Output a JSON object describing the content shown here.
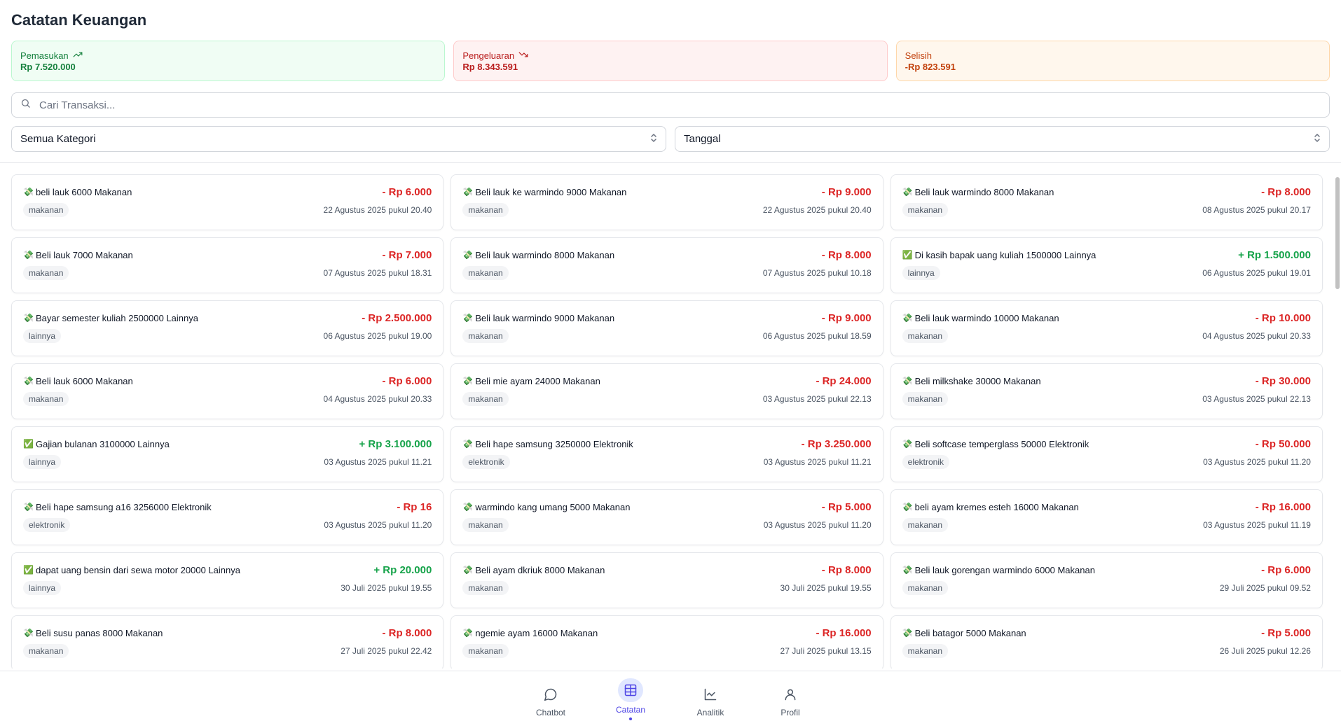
{
  "page_title": "Catatan Keuangan",
  "summary": {
    "income": {
      "label": "Pemasukan",
      "value": "Rp 7.520.000",
      "icon": "trending-up-icon",
      "color": "#15803d"
    },
    "expense": {
      "label": "Pengeluaran",
      "value": "Rp 8.343.591",
      "icon": "trending-down-icon",
      "color": "#b91c1c"
    },
    "difference": {
      "label": "Selisih",
      "value": "-Rp 823.591",
      "color": "#c2410c"
    }
  },
  "search": {
    "placeholder": "Cari Transaksi...",
    "value": ""
  },
  "filters": {
    "category": "Semua Kategori",
    "date": "Tanggal"
  },
  "transactions": [
    {
      "emoji": "💸",
      "desc": "beli lauk 6000 Makanan",
      "amount": "- Rp 6.000",
      "type": "expense",
      "category": "makanan",
      "date": "22 Agustus 2025 pukul 20.40"
    },
    {
      "emoji": "💸",
      "desc": "Beli lauk ke warmindo 9000 Makanan",
      "amount": "- Rp 9.000",
      "type": "expense",
      "category": "makanan",
      "date": "22 Agustus 2025 pukul 20.40"
    },
    {
      "emoji": "💸",
      "desc": "Beli lauk warmindo 8000 Makanan",
      "amount": "- Rp 8.000",
      "type": "expense",
      "category": "makanan",
      "date": "08 Agustus 2025 pukul 20.17"
    },
    {
      "emoji": "💸",
      "desc": "Beli lauk 7000 Makanan",
      "amount": "- Rp 7.000",
      "type": "expense",
      "category": "makanan",
      "date": "07 Agustus 2025 pukul 18.31"
    },
    {
      "emoji": "💸",
      "desc": "Beli lauk warmindo 8000 Makanan",
      "amount": "- Rp 8.000",
      "type": "expense",
      "category": "makanan",
      "date": "07 Agustus 2025 pukul 10.18"
    },
    {
      "emoji": "✅",
      "desc": "Di kasih bapak uang kuliah 1500000 Lainnya",
      "amount": "+ Rp 1.500.000",
      "type": "income",
      "category": "lainnya",
      "date": "06 Agustus 2025 pukul 19.01"
    },
    {
      "emoji": "💸",
      "desc": "Bayar semester kuliah 2500000 Lainnya",
      "amount": "- Rp 2.500.000",
      "type": "expense",
      "category": "lainnya",
      "date": "06 Agustus 2025 pukul 19.00"
    },
    {
      "emoji": "💸",
      "desc": "Beli lauk warmindo 9000 Makanan",
      "amount": "- Rp 9.000",
      "type": "expense",
      "category": "makanan",
      "date": "06 Agustus 2025 pukul 18.59"
    },
    {
      "emoji": "💸",
      "desc": "Beli lauk warmindo 10000 Makanan",
      "amount": "- Rp 10.000",
      "type": "expense",
      "category": "makanan",
      "date": "04 Agustus 2025 pukul 20.33"
    },
    {
      "emoji": "💸",
      "desc": "Beli lauk 6000 Makanan",
      "amount": "- Rp 6.000",
      "type": "expense",
      "category": "makanan",
      "date": "04 Agustus 2025 pukul 20.33"
    },
    {
      "emoji": "💸",
      "desc": "Beli mie ayam 24000 Makanan",
      "amount": "- Rp 24.000",
      "type": "expense",
      "category": "makanan",
      "date": "03 Agustus 2025 pukul 22.13"
    },
    {
      "emoji": "💸",
      "desc": "Beli milkshake 30000 Makanan",
      "amount": "- Rp 30.000",
      "type": "expense",
      "category": "makanan",
      "date": "03 Agustus 2025 pukul 22.13"
    },
    {
      "emoji": "✅",
      "desc": "Gajian bulanan 3100000 Lainnya",
      "amount": "+ Rp 3.100.000",
      "type": "income",
      "category": "lainnya",
      "date": "03 Agustus 2025 pukul 11.21"
    },
    {
      "emoji": "💸",
      "desc": "Beli hape samsung 3250000 Elektronik",
      "amount": "- Rp 3.250.000",
      "type": "expense",
      "category": "elektronik",
      "date": "03 Agustus 2025 pukul 11.21"
    },
    {
      "emoji": "💸",
      "desc": "Beli softcase temperglass 50000 Elektronik",
      "amount": "- Rp 50.000",
      "type": "expense",
      "category": "elektronik",
      "date": "03 Agustus 2025 pukul 11.20"
    },
    {
      "emoji": "💸",
      "desc": "Beli hape samsung a16 3256000 Elektronik",
      "amount": "- Rp 16",
      "type": "expense",
      "category": "elektronik",
      "date": "03 Agustus 2025 pukul 11.20"
    },
    {
      "emoji": "💸",
      "desc": "warmindo kang umang 5000 Makanan",
      "amount": "- Rp 5.000",
      "type": "expense",
      "category": "makanan",
      "date": "03 Agustus 2025 pukul 11.20"
    },
    {
      "emoji": "💸",
      "desc": "beli ayam kremes esteh 16000 Makanan",
      "amount": "- Rp 16.000",
      "type": "expense",
      "category": "makanan",
      "date": "03 Agustus 2025 pukul 11.19"
    },
    {
      "emoji": "✅",
      "desc": "dapat uang bensin dari sewa motor 20000 Lainnya",
      "amount": "+ Rp 20.000",
      "type": "income",
      "category": "lainnya",
      "date": "30 Juli 2025 pukul 19.55"
    },
    {
      "emoji": "💸",
      "desc": "Beli ayam dkriuk 8000 Makanan",
      "amount": "- Rp 8.000",
      "type": "expense",
      "category": "makanan",
      "date": "30 Juli 2025 pukul 19.55"
    },
    {
      "emoji": "💸",
      "desc": "Beli lauk gorengan warmindo 6000 Makanan",
      "amount": "- Rp 6.000",
      "type": "expense",
      "category": "makanan",
      "date": "29 Juli 2025 pukul 09.52"
    },
    {
      "emoji": "💸",
      "desc": "Beli susu panas 8000 Makanan",
      "amount": "- Rp 8.000",
      "type": "expense",
      "category": "makanan",
      "date": "27 Juli 2025 pukul 22.42"
    },
    {
      "emoji": "💸",
      "desc": "ngemie ayam 16000 Makanan",
      "amount": "- Rp 16.000",
      "type": "expense",
      "category": "makanan",
      "date": "27 Juli 2025 pukul 13.15"
    },
    {
      "emoji": "💸",
      "desc": "Beli batagor 5000 Makanan",
      "amount": "- Rp 5.000",
      "type": "expense",
      "category": "makanan",
      "date": "26 Juli 2025 pukul 12.26"
    }
  ],
  "nav": [
    {
      "label": "Chatbot",
      "icon": "chat-icon",
      "active": false
    },
    {
      "label": "Catatan",
      "icon": "table-icon",
      "active": true
    },
    {
      "label": "Analitik",
      "icon": "chart-icon",
      "active": false
    },
    {
      "label": "Profil",
      "icon": "user-icon",
      "active": false
    }
  ],
  "colors": {
    "accent": "#4f46e5",
    "income": "#16a34a",
    "expense": "#dc2626"
  }
}
